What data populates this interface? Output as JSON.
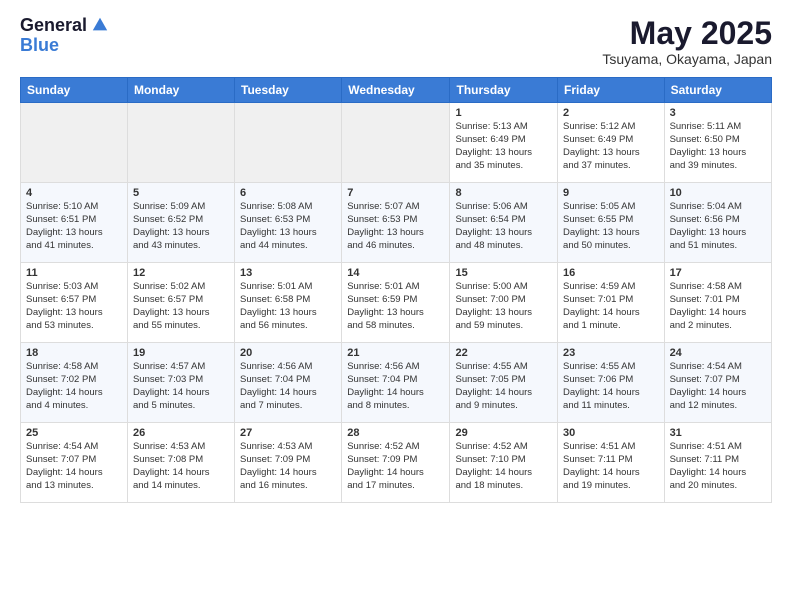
{
  "header": {
    "logo_general": "General",
    "logo_blue": "Blue",
    "month_year": "May 2025",
    "location": "Tsuyama, Okayama, Japan"
  },
  "days_of_week": [
    "Sunday",
    "Monday",
    "Tuesday",
    "Wednesday",
    "Thursday",
    "Friday",
    "Saturday"
  ],
  "weeks": [
    [
      {
        "day": "",
        "info": ""
      },
      {
        "day": "",
        "info": ""
      },
      {
        "day": "",
        "info": ""
      },
      {
        "day": "",
        "info": ""
      },
      {
        "day": "1",
        "info": "Sunrise: 5:13 AM\nSunset: 6:49 PM\nDaylight: 13 hours\nand 35 minutes."
      },
      {
        "day": "2",
        "info": "Sunrise: 5:12 AM\nSunset: 6:49 PM\nDaylight: 13 hours\nand 37 minutes."
      },
      {
        "day": "3",
        "info": "Sunrise: 5:11 AM\nSunset: 6:50 PM\nDaylight: 13 hours\nand 39 minutes."
      }
    ],
    [
      {
        "day": "4",
        "info": "Sunrise: 5:10 AM\nSunset: 6:51 PM\nDaylight: 13 hours\nand 41 minutes."
      },
      {
        "day": "5",
        "info": "Sunrise: 5:09 AM\nSunset: 6:52 PM\nDaylight: 13 hours\nand 43 minutes."
      },
      {
        "day": "6",
        "info": "Sunrise: 5:08 AM\nSunset: 6:53 PM\nDaylight: 13 hours\nand 44 minutes."
      },
      {
        "day": "7",
        "info": "Sunrise: 5:07 AM\nSunset: 6:53 PM\nDaylight: 13 hours\nand 46 minutes."
      },
      {
        "day": "8",
        "info": "Sunrise: 5:06 AM\nSunset: 6:54 PM\nDaylight: 13 hours\nand 48 minutes."
      },
      {
        "day": "9",
        "info": "Sunrise: 5:05 AM\nSunset: 6:55 PM\nDaylight: 13 hours\nand 50 minutes."
      },
      {
        "day": "10",
        "info": "Sunrise: 5:04 AM\nSunset: 6:56 PM\nDaylight: 13 hours\nand 51 minutes."
      }
    ],
    [
      {
        "day": "11",
        "info": "Sunrise: 5:03 AM\nSunset: 6:57 PM\nDaylight: 13 hours\nand 53 minutes."
      },
      {
        "day": "12",
        "info": "Sunrise: 5:02 AM\nSunset: 6:57 PM\nDaylight: 13 hours\nand 55 minutes."
      },
      {
        "day": "13",
        "info": "Sunrise: 5:01 AM\nSunset: 6:58 PM\nDaylight: 13 hours\nand 56 minutes."
      },
      {
        "day": "14",
        "info": "Sunrise: 5:01 AM\nSunset: 6:59 PM\nDaylight: 13 hours\nand 58 minutes."
      },
      {
        "day": "15",
        "info": "Sunrise: 5:00 AM\nSunset: 7:00 PM\nDaylight: 13 hours\nand 59 minutes."
      },
      {
        "day": "16",
        "info": "Sunrise: 4:59 AM\nSunset: 7:01 PM\nDaylight: 14 hours\nand 1 minute."
      },
      {
        "day": "17",
        "info": "Sunrise: 4:58 AM\nSunset: 7:01 PM\nDaylight: 14 hours\nand 2 minutes."
      }
    ],
    [
      {
        "day": "18",
        "info": "Sunrise: 4:58 AM\nSunset: 7:02 PM\nDaylight: 14 hours\nand 4 minutes."
      },
      {
        "day": "19",
        "info": "Sunrise: 4:57 AM\nSunset: 7:03 PM\nDaylight: 14 hours\nand 5 minutes."
      },
      {
        "day": "20",
        "info": "Sunrise: 4:56 AM\nSunset: 7:04 PM\nDaylight: 14 hours\nand 7 minutes."
      },
      {
        "day": "21",
        "info": "Sunrise: 4:56 AM\nSunset: 7:04 PM\nDaylight: 14 hours\nand 8 minutes."
      },
      {
        "day": "22",
        "info": "Sunrise: 4:55 AM\nSunset: 7:05 PM\nDaylight: 14 hours\nand 9 minutes."
      },
      {
        "day": "23",
        "info": "Sunrise: 4:55 AM\nSunset: 7:06 PM\nDaylight: 14 hours\nand 11 minutes."
      },
      {
        "day": "24",
        "info": "Sunrise: 4:54 AM\nSunset: 7:07 PM\nDaylight: 14 hours\nand 12 minutes."
      }
    ],
    [
      {
        "day": "25",
        "info": "Sunrise: 4:54 AM\nSunset: 7:07 PM\nDaylight: 14 hours\nand 13 minutes."
      },
      {
        "day": "26",
        "info": "Sunrise: 4:53 AM\nSunset: 7:08 PM\nDaylight: 14 hours\nand 14 minutes."
      },
      {
        "day": "27",
        "info": "Sunrise: 4:53 AM\nSunset: 7:09 PM\nDaylight: 14 hours\nand 16 minutes."
      },
      {
        "day": "28",
        "info": "Sunrise: 4:52 AM\nSunset: 7:09 PM\nDaylight: 14 hours\nand 17 minutes."
      },
      {
        "day": "29",
        "info": "Sunrise: 4:52 AM\nSunset: 7:10 PM\nDaylight: 14 hours\nand 18 minutes."
      },
      {
        "day": "30",
        "info": "Sunrise: 4:51 AM\nSunset: 7:11 PM\nDaylight: 14 hours\nand 19 minutes."
      },
      {
        "day": "31",
        "info": "Sunrise: 4:51 AM\nSunset: 7:11 PM\nDaylight: 14 hours\nand 20 minutes."
      }
    ]
  ]
}
